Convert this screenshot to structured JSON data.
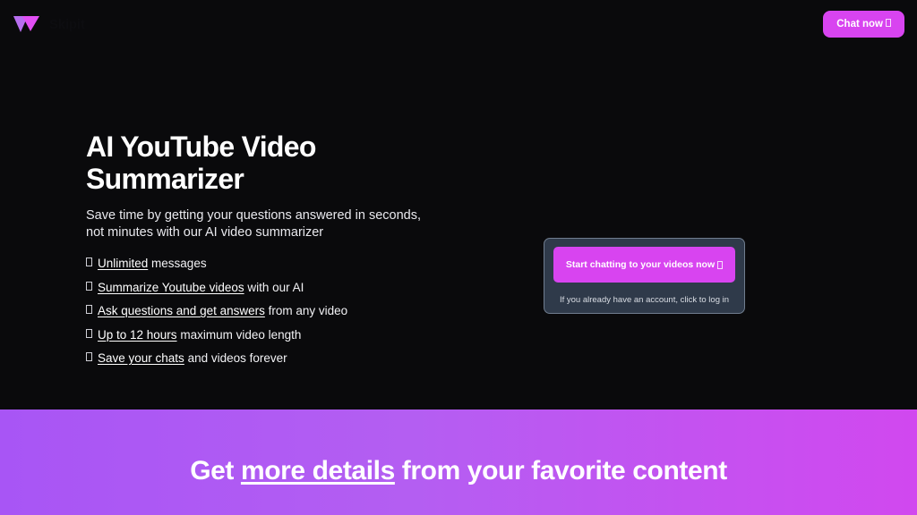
{
  "navbar": {
    "brand_name": "Skipit",
    "logo_icon": "double-triangle-logo-icon",
    "cta_label": "Chat now",
    "cta_glyph": "missing-glyph-box"
  },
  "hero": {
    "title": "AI YouTube Video Summarizer",
    "subtitle": "Save time by getting your questions answered in seconds, not minutes with our AI video summarizer",
    "features": [
      {
        "bullet": "missing-glyph-box",
        "highlight": "Unlimited",
        "rest": "messages"
      },
      {
        "bullet": "missing-glyph-box",
        "highlight": "Summarize Youtube videos",
        "rest": "with our AI"
      },
      {
        "bullet": "missing-glyph-box",
        "highlight": "Ask questions and get answers",
        "rest": "from any video"
      },
      {
        "bullet": "missing-glyph-box",
        "highlight": "Up to 12 hours",
        "rest": "maximum video length"
      },
      {
        "bullet": "missing-glyph-box",
        "highlight": "Save your chats",
        "rest": "and videos forever"
      }
    ]
  },
  "cta_card": {
    "button_label": "Start chatting to your videos now",
    "button_glyph": "missing-glyph-box",
    "login_text": "If you already have an account, click to log in"
  },
  "banner": {
    "text_before": "Get ",
    "text_underlined": "more details",
    "text_after": " from your favorite content"
  },
  "colors": {
    "background": "#0a0a0c",
    "accent_magenta": "#d844f0",
    "banner_gradient_start": "#a855f5",
    "banner_gradient_end": "#d148ef",
    "card_background": "#2f3a4a",
    "card_border": "#707d8f"
  }
}
